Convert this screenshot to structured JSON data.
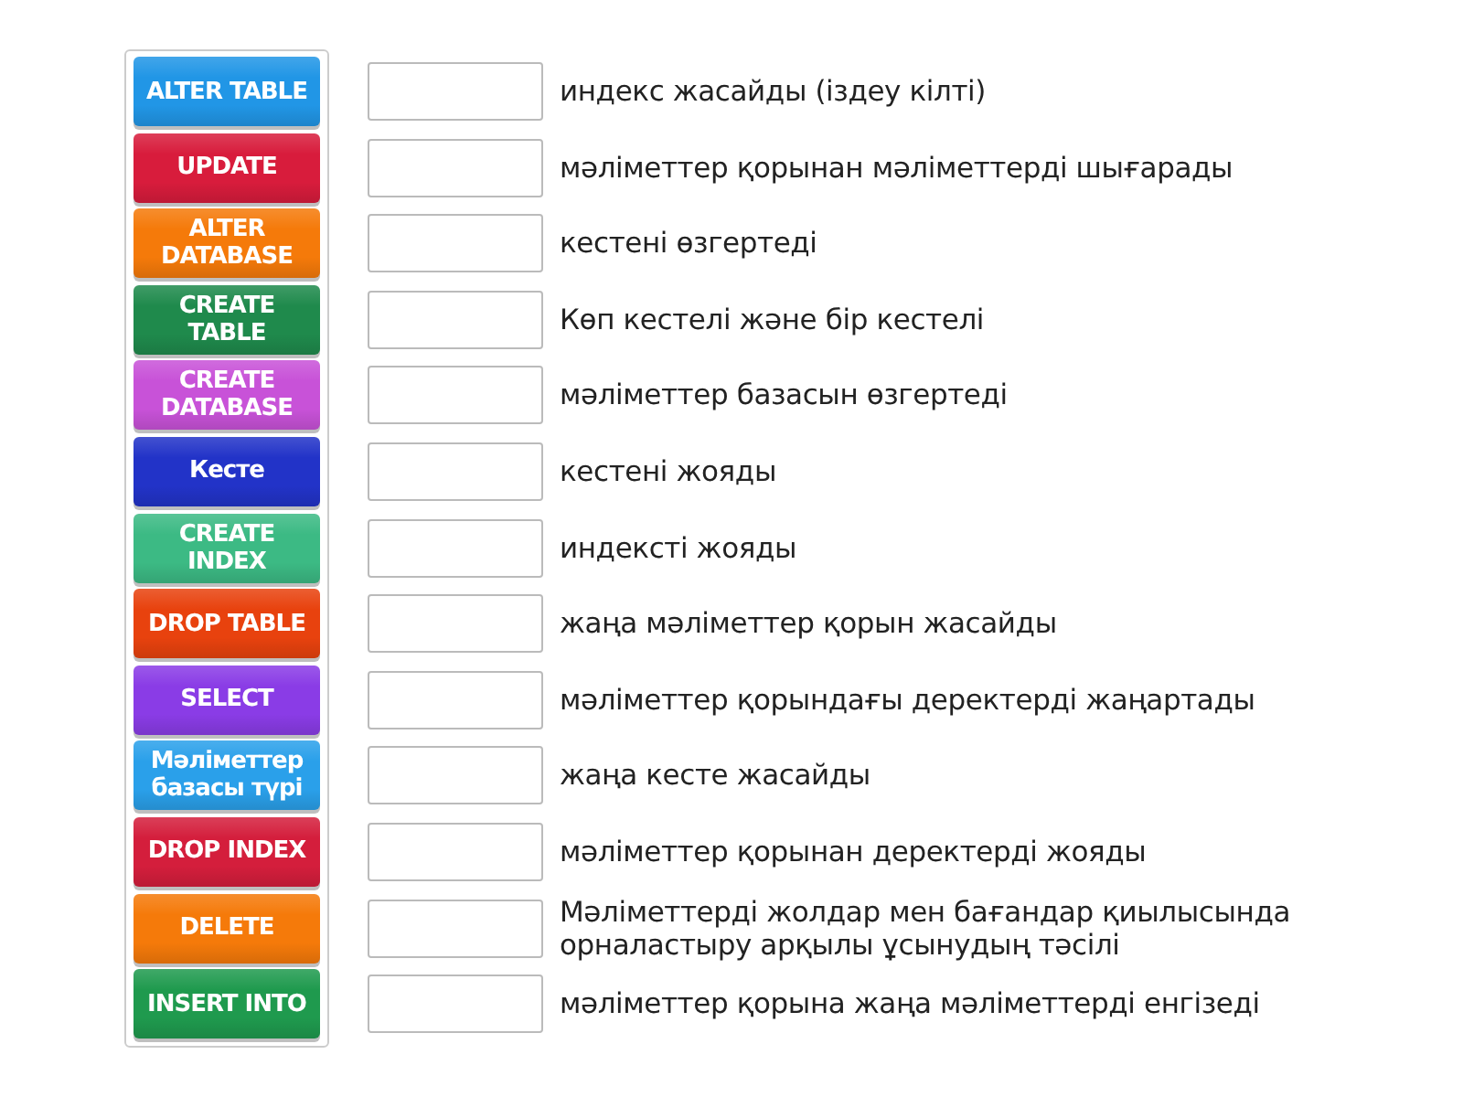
{
  "tiles": [
    {
      "label": "ALTER TABLE",
      "color": "#2196e6"
    },
    {
      "label": "UPDATE",
      "color": "#d81c3c"
    },
    {
      "label": "ALTER DATABASE",
      "color": "#f57a0a"
    },
    {
      "label": "CREATE TABLE",
      "color": "#1f8a4c"
    },
    {
      "label": "CREATE DATABASE",
      "color": "#c852d8"
    },
    {
      "label": "Кесте",
      "color": "#2233c8"
    },
    {
      "label": "CREATE INDEX",
      "color": "#3cba84"
    },
    {
      "label": "DROP TABLE",
      "color": "#e8420e"
    },
    {
      "label": "SELECT",
      "color": "#8a3ce6"
    },
    {
      "label": "Мәліметтер базасы түрі",
      "color": "#2aa0ea"
    },
    {
      "label": "DROP INDEX",
      "color": "#d41e3c"
    },
    {
      "label": "DELETE",
      "color": "#f57a0a"
    },
    {
      "label": "INSERT INTO",
      "color": "#1f9a4e"
    }
  ],
  "definitions": [
    "индекс жасайды (іздеу кілті)",
    "мәліметтер қорынан мәліметтерді шығарады",
    "кестені өзгертеді",
    "Көп кестелі және бір кестелі",
    "мәліметтер базасын өзгертеді",
    "кестені жояды",
    "индексті жояды",
    "жаңа мәліметтер қорын жасайды",
    "мәліметтер қорындағы деректерді жаңартады",
    "жаңа кесте жасайды",
    "мәліметтер қорынан деректерді жояды",
    "Мәліметтерді жолдар мен бағандар қиылысында орналастыру арқылы ұсынудың тәсілі",
    "мәліметтер қорына жаңа мәліметтерді енгізеді"
  ]
}
